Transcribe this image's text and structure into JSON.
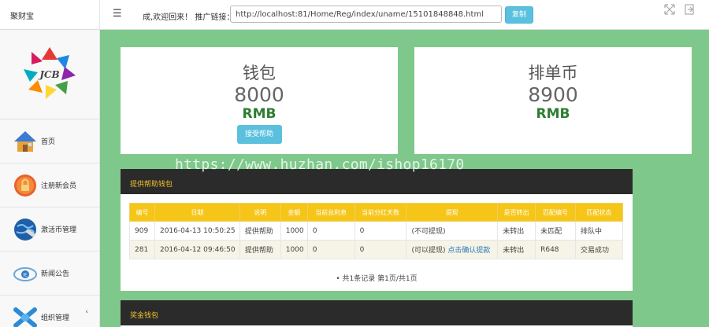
{
  "header": {
    "brand": "聚财宝",
    "menu_icon": "menu-icon",
    "welcome": "成,欢迎回来！ 推广链接：",
    "referral_link": "http://localhost:81/Home/Reg/index/uname/15101848848.html",
    "copy_label": "复制",
    "icons": [
      "fullscreen-icon",
      "logout-icon"
    ]
  },
  "sidebar": {
    "items": [
      {
        "label": "首页",
        "icon": "home-icon"
      },
      {
        "label": "注册新会员",
        "icon": "lock-icon"
      },
      {
        "label": "激活币管理",
        "icon": "globe-icon"
      },
      {
        "label": "新闻公告",
        "icon": "news-icon"
      },
      {
        "label": "组织管理",
        "icon": "network-icon"
      }
    ],
    "caret": "‹"
  },
  "stats": [
    {
      "title": "钱包",
      "value": "8000",
      "unit": "RMB",
      "button": "接受帮助"
    },
    {
      "title": "排单币",
      "value": "8900",
      "unit": "RMB"
    }
  ],
  "help_panel": {
    "title": "提供帮助钱包",
    "columns": [
      "编号",
      "日期",
      "说明",
      "金额",
      "当前总利息",
      "当前分红天数",
      "提现",
      "是否转出",
      "匹配编号",
      "匹配状态"
    ],
    "rows": [
      {
        "id": "909",
        "date": "2016-04-13 10:50:25",
        "desc": "提供帮助",
        "amount": "1000",
        "interest": "0",
        "days": "0",
        "withdraw": "(不可提现)",
        "withdraw_link": "",
        "transferred": "未转出",
        "match_no": "未匹配",
        "status": "排队中"
      },
      {
        "id": "281",
        "date": "2016-04-12 09:46:50",
        "desc": "提供帮助",
        "amount": "1000",
        "interest": "0",
        "days": "0",
        "withdraw": "(可以提现)",
        "withdraw_link": "点击确认提款",
        "transferred": "未转出",
        "match_no": "R648",
        "status": "交易成功"
      }
    ],
    "pager": "共1条记录 第1页/共1页"
  },
  "bonus_panel": {
    "title": "奖金钱包"
  },
  "watermark": "https://www.huzhan.com/ishop16170",
  "colors": {
    "main_bg": "#7fc88b",
    "header_dark": "#2b2b2b",
    "table_head": "#f5c518",
    "accent_button": "#5bc0de",
    "unit_green": "#2e7d32"
  }
}
